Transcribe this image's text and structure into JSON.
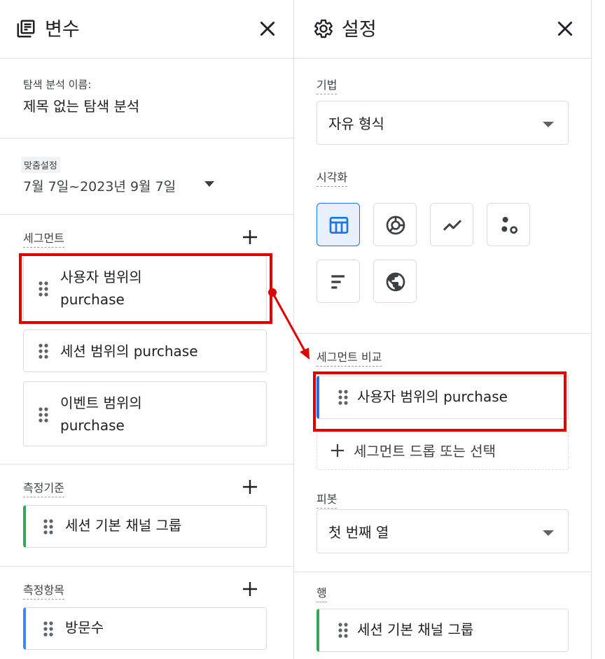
{
  "variables_panel": {
    "title": "변수",
    "exploration_name_label": "탐색 분석 이름:",
    "exploration_name": "제목 없는 탐색 분석",
    "date_range": {
      "chip": "맞춤설정",
      "value": "7월 7일~2023년 9월 7일"
    },
    "segments": {
      "label": "세그먼트",
      "items": [
        "사용자 범위의 purchase",
        "세션 범위의 purchase",
        "이벤트 범위의 purchase"
      ],
      "item_lines": [
        [
          "사용자 범위의",
          "purchase"
        ],
        [
          "세션 범위의 purchase"
        ],
        [
          "이벤트 범위의",
          "purchase"
        ]
      ]
    },
    "dimensions": {
      "label": "측정기준",
      "items": [
        "세션 기본 채널 그룹"
      ]
    },
    "metrics": {
      "label": "측정항목",
      "items": [
        "방문수"
      ]
    }
  },
  "settings_panel": {
    "title": "설정",
    "technique": {
      "label": "기법",
      "value": "자유 형식"
    },
    "visualization": {
      "label": "시각화",
      "options": [
        "table-icon",
        "donut-chart-icon",
        "line-chart-icon",
        "scatter-plot-icon",
        "bar-chart-icon",
        "geo-map-icon"
      ],
      "selected": "table-icon"
    },
    "segment_comparison": {
      "label": "세그먼트 비교",
      "items": [
        "사용자 범위의 purchase"
      ],
      "drop_hint": "세그먼트 드롭 또는 선택"
    },
    "pivot": {
      "label": "피봇",
      "value": "첫 번째 열"
    },
    "rows": {
      "label": "행",
      "items": [
        "세션 기본 채널 그룹"
      ]
    }
  },
  "colors": {
    "annotation_red": "#e00000",
    "accent_blue": "#1a73e8",
    "accent_green": "#34a853"
  }
}
